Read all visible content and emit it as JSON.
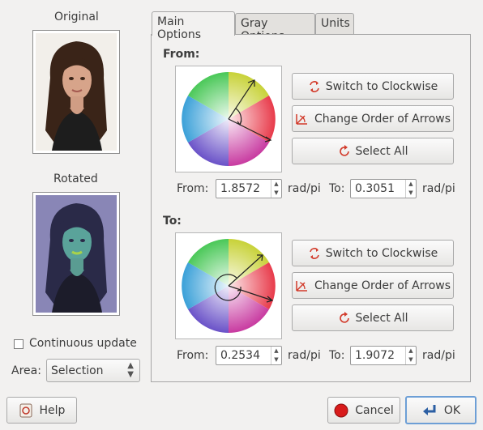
{
  "previews": {
    "original_label": "Original",
    "rotated_label": "Rotated"
  },
  "controls": {
    "continuous_update_label": "Continuous update",
    "continuous_update_checked": false,
    "area_label": "Area:",
    "area_value": "Selection"
  },
  "tabs": [
    {
      "label": "Main Options",
      "active": true
    },
    {
      "label": "Gray Options",
      "active": false
    },
    {
      "label": "Units",
      "active": false
    }
  ],
  "from_section": {
    "title": "From:",
    "buttons": {
      "switch": "Switch to Clockwise",
      "order": "Change Order of Arrows",
      "select_all": "Select All"
    },
    "from_label": "From:",
    "from_value": "1.8572",
    "from_unit": "rad/pi",
    "to_label": "To:",
    "to_value": "0.3051",
    "to_unit": "rad/pi"
  },
  "to_section": {
    "title": "To:",
    "buttons": {
      "switch": "Switch to Clockwise",
      "order": "Change Order of Arrows",
      "select_all": "Select All"
    },
    "from_label": "From:",
    "from_value": "0.2534",
    "from_unit": "rad/pi",
    "to_label": "To:",
    "to_value": "1.9072",
    "to_unit": "rad/pi"
  },
  "footer": {
    "help": "Help",
    "cancel": "Cancel",
    "ok": "OK"
  },
  "colors": {
    "cancel_icon": "#d81b1b",
    "refresh_icon": "#d23a2a",
    "ok_border": "#6d9fd6"
  },
  "icons": {
    "help": "help-icon",
    "cancel": "stop-icon",
    "ok": "return-arrow-icon",
    "switch": "rotate-icon",
    "order": "order-arrows-icon",
    "select_all": "refresh-icon"
  }
}
